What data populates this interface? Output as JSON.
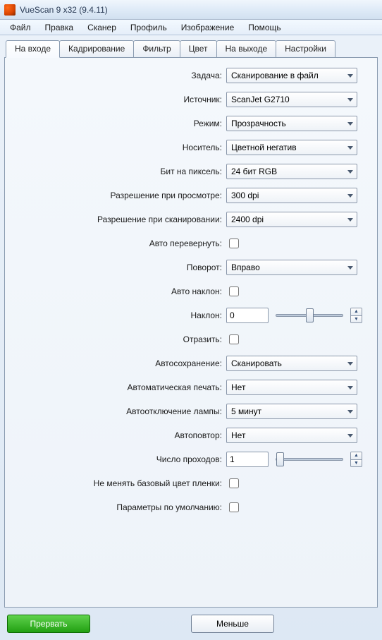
{
  "title": "VueScan 9 x32 (9.4.11)",
  "menu": [
    "Файл",
    "Правка",
    "Сканер",
    "Профиль",
    "Изображение",
    "Помощь"
  ],
  "tabs": [
    "На входе",
    "Кадрирование",
    "Фильтр",
    "Цвет",
    "На выходе",
    "Настройки"
  ],
  "active_tab": 0,
  "form": {
    "task": {
      "label": "Задача:",
      "value": "Сканирование в файл"
    },
    "source": {
      "label": "Источник:",
      "value": "ScanJet G2710"
    },
    "mode": {
      "label": "Режим:",
      "value": "Прозрачность"
    },
    "media": {
      "label": "Носитель:",
      "value": "Цветной негатив"
    },
    "bpp": {
      "label": "Бит на пиксель:",
      "value": "24 бит RGB"
    },
    "preview_res": {
      "label": "Разрешение при просмотре:",
      "value": "300 dpi"
    },
    "scan_res": {
      "label": "Разрешение при сканировании:",
      "value": "2400 dpi"
    },
    "auto_flip": {
      "label": "Авто перевернуть:",
      "checked": false
    },
    "rotation": {
      "label": "Поворот:",
      "value": "Вправо"
    },
    "auto_skew": {
      "label": "Авто наклон:",
      "checked": false
    },
    "skew": {
      "label": "Наклон:",
      "value": "0",
      "slider": 50
    },
    "mirror": {
      "label": "Отразить:",
      "checked": false
    },
    "autosave": {
      "label": "Автосохранение:",
      "value": "Сканировать"
    },
    "autoprint": {
      "label": "Автоматическая печать:",
      "value": "Нет"
    },
    "lamp_off": {
      "label": "Автоотключение лампы:",
      "value": "5 минут"
    },
    "autorepeat": {
      "label": "Автоповтор:",
      "value": "Нет"
    },
    "passes": {
      "label": "Число проходов:",
      "value": "1",
      "slider": 0
    },
    "keep_base_color": {
      "label": "Не менять базовый цвет пленки:",
      "checked": false
    },
    "defaults": {
      "label": "Параметры по умолчанию:",
      "checked": false
    }
  },
  "buttons": {
    "abort": "Прервать",
    "less": "Меньше"
  }
}
